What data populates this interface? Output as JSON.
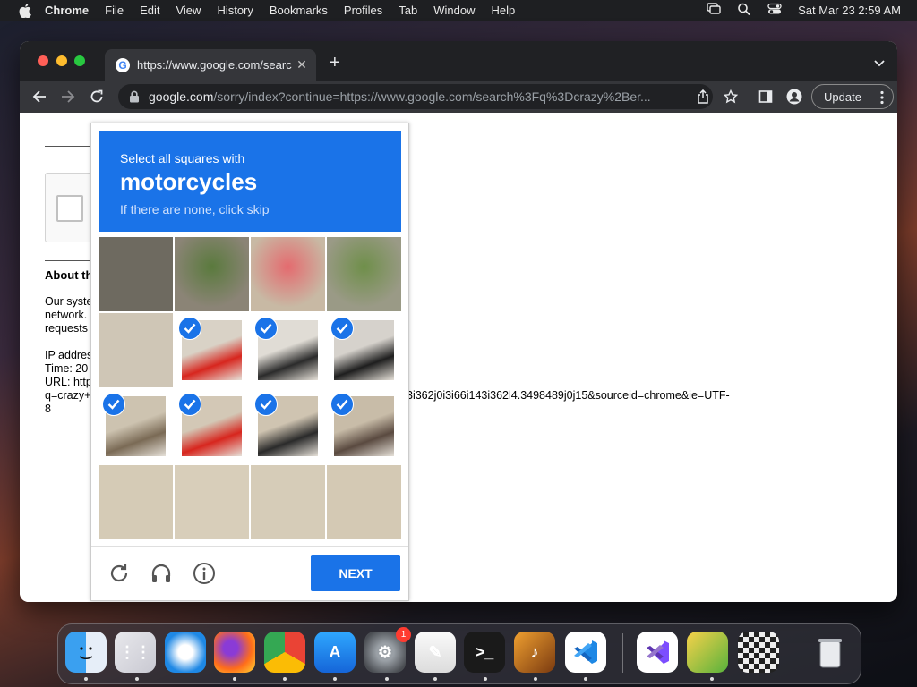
{
  "menubar": {
    "app": "Chrome",
    "items": [
      "File",
      "Edit",
      "View",
      "History",
      "Bookmarks",
      "Profiles",
      "Tab",
      "Window",
      "Help"
    ],
    "datetime": "Sat Mar 23  2:59 AM"
  },
  "tab": {
    "title": "https://www.google.com/searc",
    "favicon_letter": "G"
  },
  "omnibox": {
    "host": "google.com",
    "path": "/sorry/index?continue=https://www.google.com/search%3Fq%3Dcrazy%2Ber..."
  },
  "toolbar": {
    "update_label": "Update"
  },
  "page": {
    "about_heading": "About th",
    "para1": [
      "Our syste",
      "network.",
      "requests"
    ],
    "para2": [
      "IP addres",
      "Time: 20",
      "URL: http",
      "q=crazy+",
      "8"
    ],
    "url_tail": "3i362j0i3i66i143i362l4.3498489j0j15&sourceid=chrome&ie=UTF-"
  },
  "captcha": {
    "line1": "Select all squares with",
    "line2": "motorcycles",
    "line3": "If there are none, click skip",
    "next_label": "NEXT",
    "selected": [
      [
        false,
        false,
        false,
        false
      ],
      [
        false,
        true,
        true,
        true
      ],
      [
        true,
        true,
        true,
        true
      ],
      [
        false,
        false,
        false,
        false
      ]
    ]
  },
  "dock": {
    "apps": [
      "finder",
      "launchpad",
      "safari",
      "firefox",
      "chrome",
      "app-store",
      "system-settings",
      "textedit",
      "terminal",
      "garageband",
      "vscode",
      "visual-studio",
      "game-app",
      "chess",
      "trash"
    ],
    "settings_badge": "1"
  },
  "colors": {
    "accent": "#1a73e8",
    "chrome_dark": "#35363a"
  }
}
